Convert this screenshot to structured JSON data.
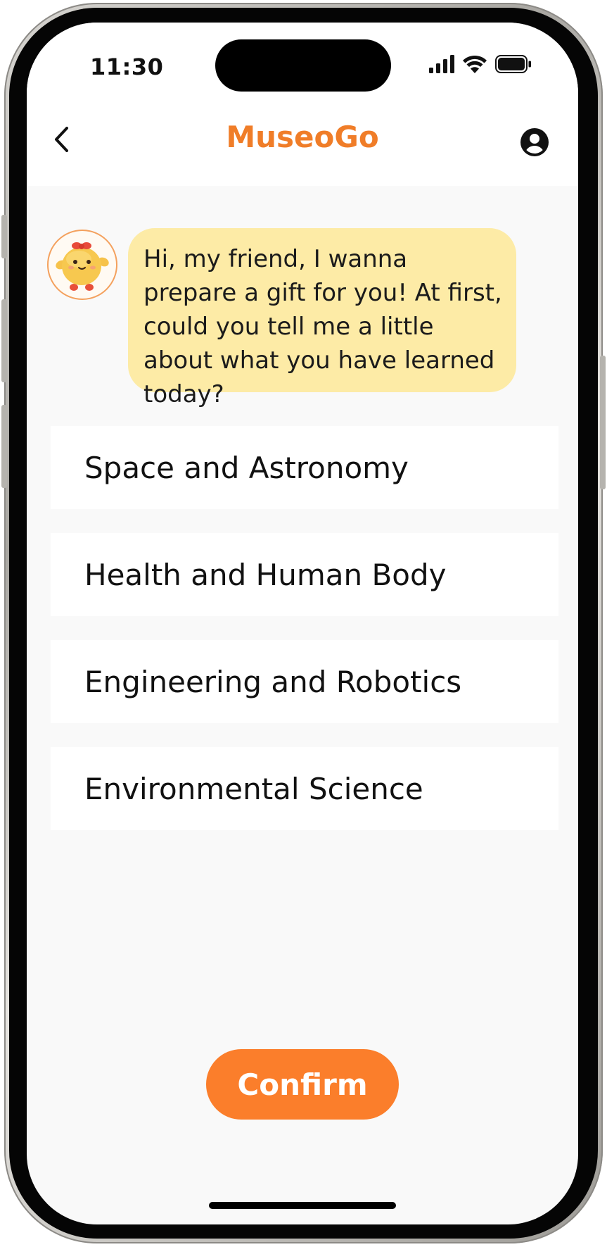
{
  "status_bar": {
    "time": "11:30"
  },
  "header": {
    "title": "MuseoGo",
    "back_icon": "chevron-left-icon",
    "profile_icon": "user-circle-icon"
  },
  "chat": {
    "mascot": "chick-mascot-avatar",
    "message": "Hi, my friend, I wanna prepare a gift for you! At first, could you tell me a little about what you have learned today?"
  },
  "options": [
    {
      "label": "Space and Astronomy"
    },
    {
      "label": "Health and Human Body"
    },
    {
      "label": "Engineering and Robotics"
    },
    {
      "label": "Environmental Science"
    }
  ],
  "confirm_label": "Confirm",
  "colors": {
    "accent": "#fb7e2b",
    "title": "#f07d28",
    "bubble": "#fdeba6",
    "background": "#f9f9f9"
  }
}
